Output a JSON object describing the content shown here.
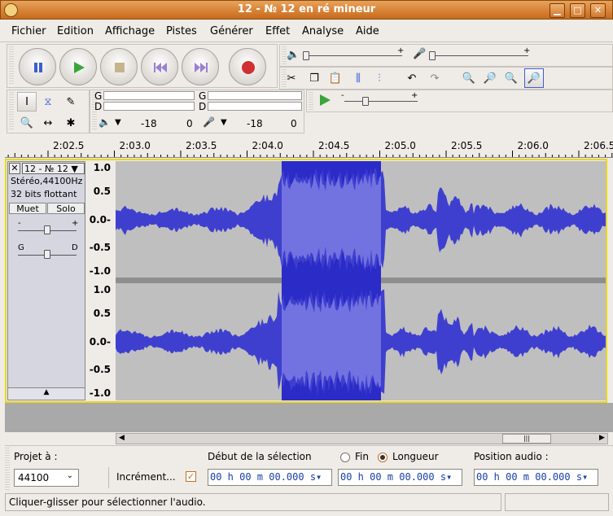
{
  "window": {
    "title": "12 - № 12 en ré mineur"
  },
  "menu": [
    "Fichier",
    "Edition",
    "Affichage",
    "Pistes",
    "Générer",
    "Effet",
    "Analyse",
    "Aide"
  ],
  "meter": {
    "left_label": "G",
    "right_label": "D",
    "play_db": "-18",
    "play_zero": "0",
    "rec_db": "-18",
    "rec_zero": "0"
  },
  "ruler": [
    "2:02.5",
    "2:03.0",
    "2:03.5",
    "2:04.0",
    "2:04.5",
    "2:05.0",
    "2:05.5",
    "2:06.0",
    "2:06.5"
  ],
  "track": {
    "name": "12 - № 12",
    "format": "Stéréo,44100Hz",
    "depth": "32 bits flottant",
    "mute": "Muet",
    "solo": "Solo",
    "gain_minus": "-",
    "gain_plus": "+",
    "pan_left": "G",
    "pan_right": "D",
    "y_labels": [
      "1.0",
      "0.5",
      "0.0-",
      "-0.5",
      "-1.0"
    ]
  },
  "bottom": {
    "project_rate_label": "Projet à :",
    "project_rate": "44100",
    "snap_label": "Incrément...",
    "selection_start_label": "Début de la sélection",
    "end_label": "Fin",
    "length_label": "Longueur",
    "audio_pos_label": "Position audio :",
    "time1": "00 h 00 m 00.000 s",
    "time2": "00 h 00 m 00.000 s",
    "time3": "00 h 00 m 00.000 s"
  },
  "status": "Cliquer-glisser pour sélectionner l'audio.",
  "colors": {
    "wave": "#3f3fcf",
    "wave_sel": "#7272e0",
    "sel_bg": "#2b2bc8",
    "bg": "#bfbfbf"
  }
}
